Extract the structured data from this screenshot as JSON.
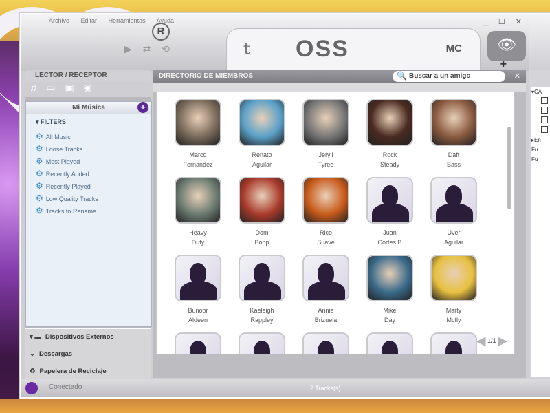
{
  "menu": {
    "items": [
      "Archivo",
      "Editar",
      "Herramientas",
      "Ayuda"
    ]
  },
  "window_controls": {
    "minimize": "_",
    "maximize": "☐",
    "close": "✕"
  },
  "branding": {
    "registered": "R",
    "logo_text": "OSS",
    "mc_label": "MC",
    "twitter_glyph": "t"
  },
  "transport": {
    "label": "▶ ⇄ ⟲"
  },
  "left_panel": {
    "header": "LECTOR / RECEPTOR",
    "section_title": "Mi Música",
    "filters_title": "FILTERS",
    "filters": [
      "All Music",
      "Loose Tracks",
      "Most Played",
      "Recently Added",
      "Recently Played",
      "Low Quality Tracks",
      "Tracks to Rename"
    ],
    "bottom_items": [
      "Dispositivos Externos",
      "Descargas",
      "Papelera de Reciclaje"
    ]
  },
  "center": {
    "title": "DIRECTORIO DE MIEMBROS",
    "search_placeholder": "Buscar a un amigo",
    "members": [
      {
        "first": "Marco",
        "last": "Fernandez",
        "color": "#7a6a5a"
      },
      {
        "first": "Renato",
        "last": "Aguilar",
        "color": "#5aa0c8"
      },
      {
        "first": "Jeryll",
        "last": "Tyree",
        "color": "#777777"
      },
      {
        "first": "Rock",
        "last": "Steady",
        "color": "#4a2a20"
      },
      {
        "first": "Daft",
        "last": "Bass",
        "color": "#8a5a40"
      },
      {
        "first": "Heavy",
        "last": "Duty",
        "color": "#6a7a70"
      },
      {
        "first": "Dom",
        "last": "Bopp",
        "color": "#a83a2a"
      },
      {
        "first": "Rico",
        "last": "Suave",
        "color": "#c85a1a"
      },
      {
        "first": "Juan",
        "last": "Cortes B",
        "color": ""
      },
      {
        "first": "Uver",
        "last": "Aguilar",
        "color": ""
      },
      {
        "first": "Bunoor",
        "last": "Aldeen",
        "color": ""
      },
      {
        "first": "Kaeleigh",
        "last": "Rappley",
        "color": ""
      },
      {
        "first": "Annie",
        "last": "Brizuela",
        "color": ""
      },
      {
        "first": "Mike",
        "last": "Day",
        "color": "#3a6a8a"
      },
      {
        "first": "Marty",
        "last": "Mcfly",
        "color": "#e8c040"
      }
    ],
    "pager": "1/1"
  },
  "right_panel": {
    "items": [
      "CA",
      "En",
      "Fu",
      "Fu"
    ]
  },
  "status": {
    "left": "Conectado",
    "center": "2 Tracks(s)"
  }
}
